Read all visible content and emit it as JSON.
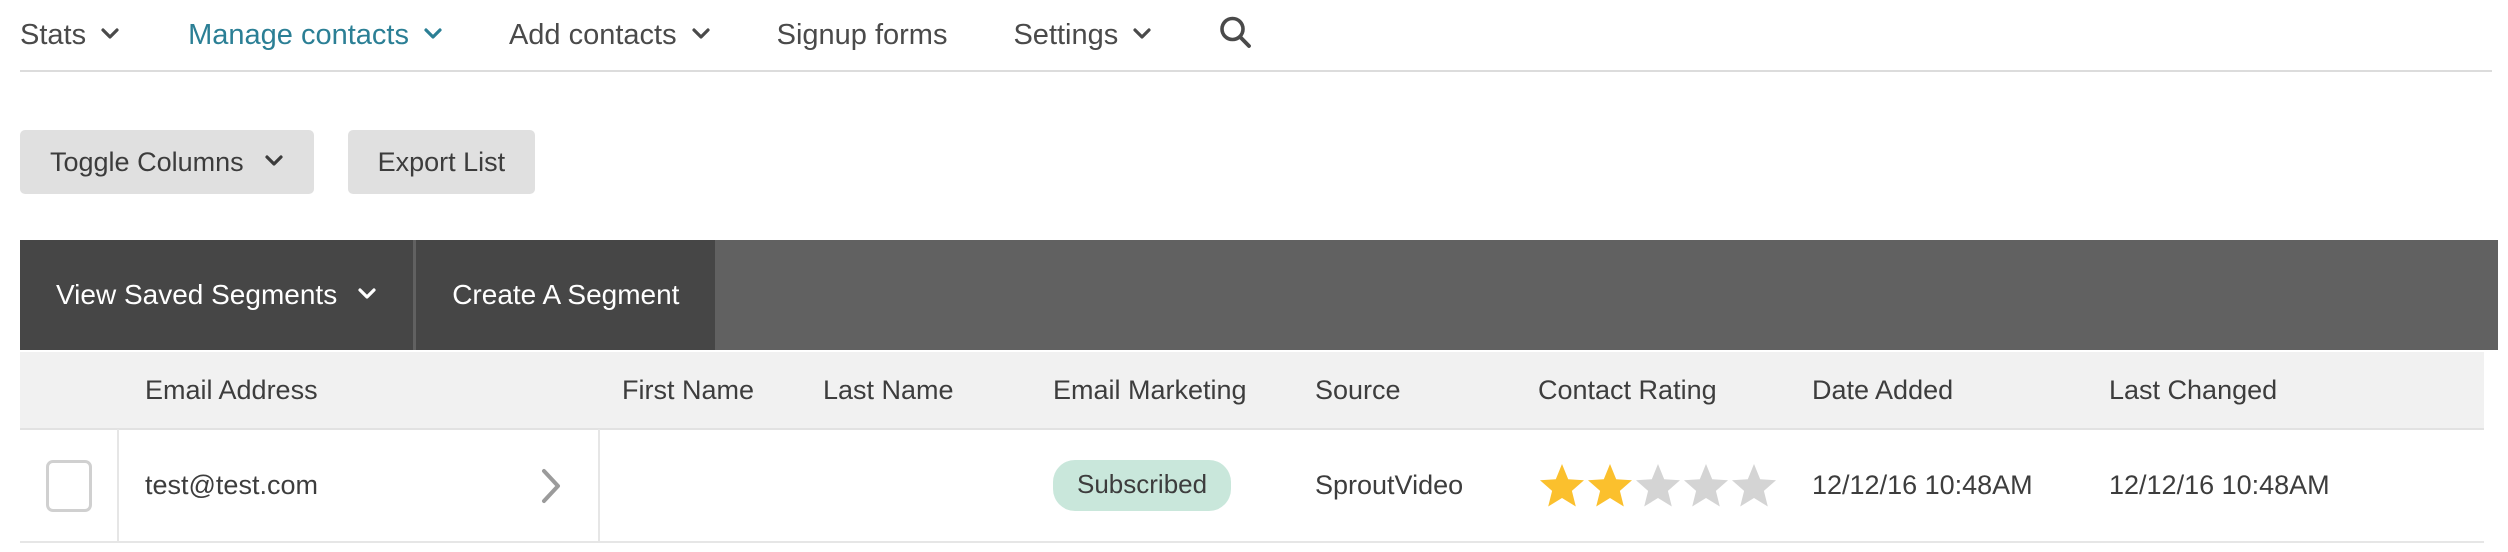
{
  "topnav": {
    "items": [
      {
        "label": "Stats",
        "has_caret": true,
        "active": false
      },
      {
        "label": "Manage contacts",
        "has_caret": true,
        "active": true
      },
      {
        "label": "Add contacts",
        "has_caret": true,
        "active": false
      },
      {
        "label": "Signup forms",
        "has_caret": false,
        "active": false
      },
      {
        "label": "Settings",
        "has_caret": true,
        "active": false
      }
    ],
    "search_icon": "search-icon",
    "active_color": "#2b7f95",
    "text_color": "#4a4a4a"
  },
  "toolbar": {
    "toggle_columns_label": "Toggle Columns",
    "export_list_label": "Export List",
    "button_bg": "#e0e0e0"
  },
  "segment_bar": {
    "view_saved_segments_label": "View Saved Segments",
    "create_a_segment_label": "Create A Segment",
    "button_bg": "#464646",
    "bar_bg": "#616161"
  },
  "table": {
    "header_bg": "#f1f1f1",
    "columns": [
      "Email Address",
      "First Name",
      "Last Name",
      "Email Marketing",
      "Source",
      "Contact Rating",
      "Date Added",
      "Last Changed"
    ],
    "rows": [
      {
        "selected": false,
        "email": "test@test.com",
        "first_name": "",
        "last_name": "",
        "email_marketing": "Subscribed",
        "email_marketing_badge_bg": "#c9e7db",
        "source": "SproutVideo",
        "contact_rating": 2,
        "contact_rating_max": 5,
        "star_filled_color": "#fbc02d",
        "star_empty_color": "#d4d4d4",
        "date_added": "12/12/16 10:48AM",
        "last_changed": "12/12/16 10:48AM"
      }
    ]
  }
}
